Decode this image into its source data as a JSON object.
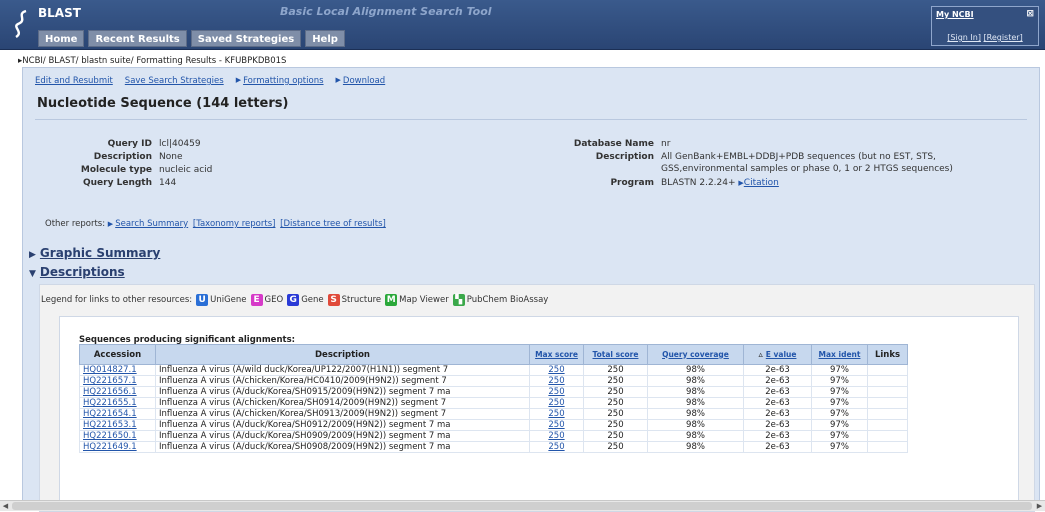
{
  "header": {
    "brand": "BLAST",
    "tagline": "Basic Local Alignment Search Tool",
    "nav": [
      "Home",
      "Recent Results",
      "Saved Strategies",
      "Help"
    ],
    "myncbi": {
      "title": "My NCBI",
      "close": "⊠",
      "sign_in": "[Sign In]",
      "register": "[Register]"
    }
  },
  "breadcrumb": "NCBI/ BLAST/ blastn suite/ Formatting Results - KFUBPKDB01S",
  "toolbar": {
    "edit": "Edit and Resubmit",
    "save": "Save Search Strategies",
    "formatting": "Formatting options",
    "download": "Download"
  },
  "title": "Nucleotide Sequence (144 letters)",
  "query": {
    "labels": [
      "Query ID",
      "Description",
      "Molecule type",
      "Query Length"
    ],
    "values": [
      "lcl|40459",
      "None",
      "nucleic acid",
      "144"
    ]
  },
  "database": {
    "name_label": "Database Name",
    "name_value": "nr",
    "desc_label": "Description",
    "desc_value": "All GenBank+EMBL+DDBJ+PDB sequences (but no EST, STS, GSS,environmental samples or phase 0, 1 or 2 HTGS sequences)",
    "program_label": "Program",
    "program_value": "BLASTN 2.2.24+",
    "citation": "Citation"
  },
  "other_reports": {
    "label": "Other reports:",
    "links": [
      "Search Summary",
      "[Taxonomy reports]",
      "[Distance tree of results]"
    ]
  },
  "sections": {
    "graphic": "Graphic Summary",
    "descriptions": "Descriptions"
  },
  "legend": {
    "label": "Legend for links to other resources:",
    "items": [
      {
        "badge": "U",
        "color": "#2a6fd6",
        "label": "UniGene"
      },
      {
        "badge": "E",
        "color": "#d63ac8",
        "label": "GEO"
      },
      {
        "badge": "G",
        "color": "#2a3ad6",
        "label": "Gene"
      },
      {
        "badge": "S",
        "color": "#e04a3a",
        "label": "Structure"
      },
      {
        "badge": "M",
        "color": "#2aa83a",
        "label": "Map Viewer"
      },
      {
        "badge": "",
        "color": "#3aa84a",
        "label": "PubChem BioAssay"
      }
    ]
  },
  "results": {
    "title": "Sequences producing significant alignments:",
    "headers": [
      "Accession",
      "Description",
      "Max score",
      "Total score",
      "Query coverage",
      "E value",
      "Max ident",
      "Links"
    ],
    "rows": [
      [
        "HQ014827.1",
        "Influenza A virus (A/wild duck/Korea/UP122/2007(H1N1)) segment 7",
        "250",
        "250",
        "98%",
        "2e-63",
        "97%"
      ],
      [
        "HQ221657.1",
        "Influenza A virus (A/chicken/Korea/HC0410/2009(H9N2)) segment 7",
        "250",
        "250",
        "98%",
        "2e-63",
        "97%"
      ],
      [
        "HQ221656.1",
        "Influenza A virus (A/duck/Korea/SH0915/2009(H9N2)) segment 7 ma",
        "250",
        "250",
        "98%",
        "2e-63",
        "97%"
      ],
      [
        "HQ221655.1",
        "Influenza A virus (A/chicken/Korea/SH0914/2009(H9N2)) segment 7",
        "250",
        "250",
        "98%",
        "2e-63",
        "97%"
      ],
      [
        "HQ221654.1",
        "Influenza A virus (A/chicken/Korea/SH0913/2009(H9N2)) segment 7",
        "250",
        "250",
        "98%",
        "2e-63",
        "97%"
      ],
      [
        "HQ221653.1",
        "Influenza A virus (A/duck/Korea/SH0912/2009(H9N2)) segment 7 ma",
        "250",
        "250",
        "98%",
        "2e-63",
        "97%"
      ],
      [
        "HQ221650.1",
        "Influenza A virus (A/duck/Korea/SH0909/2009(H9N2)) segment 7 ma",
        "250",
        "250",
        "98%",
        "2e-63",
        "97%"
      ],
      [
        "HQ221649.1",
        "Influenza A virus (A/duck/Korea/SH0908/2009(H9N2)) segment 7 ma",
        "250",
        "250",
        "98%",
        "2e-63",
        "97%"
      ]
    ]
  }
}
